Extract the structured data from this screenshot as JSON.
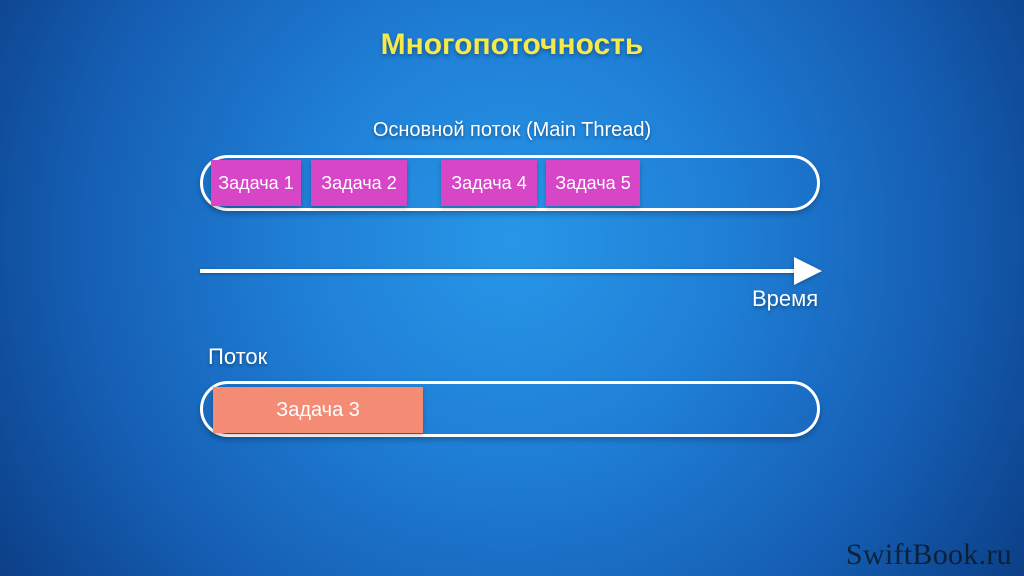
{
  "title": "Многопоточность",
  "main_thread": {
    "label": "Основной поток (Main Thread)",
    "tasks": {
      "t1": "Задача 1",
      "t2": "Задача 2",
      "t4": "Задача 4",
      "t5": "Задача 5"
    }
  },
  "secondary_thread": {
    "label": "Поток",
    "tasks": {
      "t3": "Задача 3"
    }
  },
  "time_label": "Время",
  "watermark": "SwiftBook.ru",
  "colors": {
    "task_magenta": "#d846c8",
    "task_salmon": "#f48b74",
    "title_yellow": "#f6e94b"
  }
}
